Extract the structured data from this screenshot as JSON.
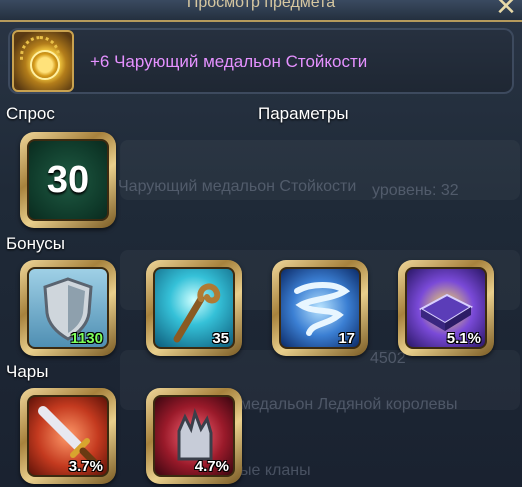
{
  "dialog": {
    "title": "Просмотр предмета",
    "close_icon": "close-x-icon"
  },
  "item": {
    "name": "+6 Чарующий медальон Стойкости",
    "icon": "golden-medallion-icon",
    "name_color": "#e591ff"
  },
  "sections": {
    "demand_label": "Спрос",
    "params_label": "Параметры",
    "bonuses_label": "Бонусы",
    "enchant_label": "Чары"
  },
  "demand": {
    "value": "30"
  },
  "bonuses": [
    {
      "icon": "shield-icon",
      "value": "1130",
      "value_color": "#7dff5a"
    },
    {
      "icon": "staff-icon",
      "value": "35"
    },
    {
      "icon": "whirlwind-icon",
      "value": "17"
    },
    {
      "icon": "spellbook-icon",
      "value": "5.1%"
    }
  ],
  "enchants": [
    {
      "icon": "sword-icon",
      "value": "3.7%"
    },
    {
      "icon": "gauntlet-icon",
      "value": "4.7%"
    }
  ],
  "background": {
    "line_1": "Чарующий медальон Стойкости",
    "line_2": "уровень: 32",
    "line_3": "4502",
    "line_4": "медальон Ледяной королевы",
    "line_5": "ые кланы"
  }
}
